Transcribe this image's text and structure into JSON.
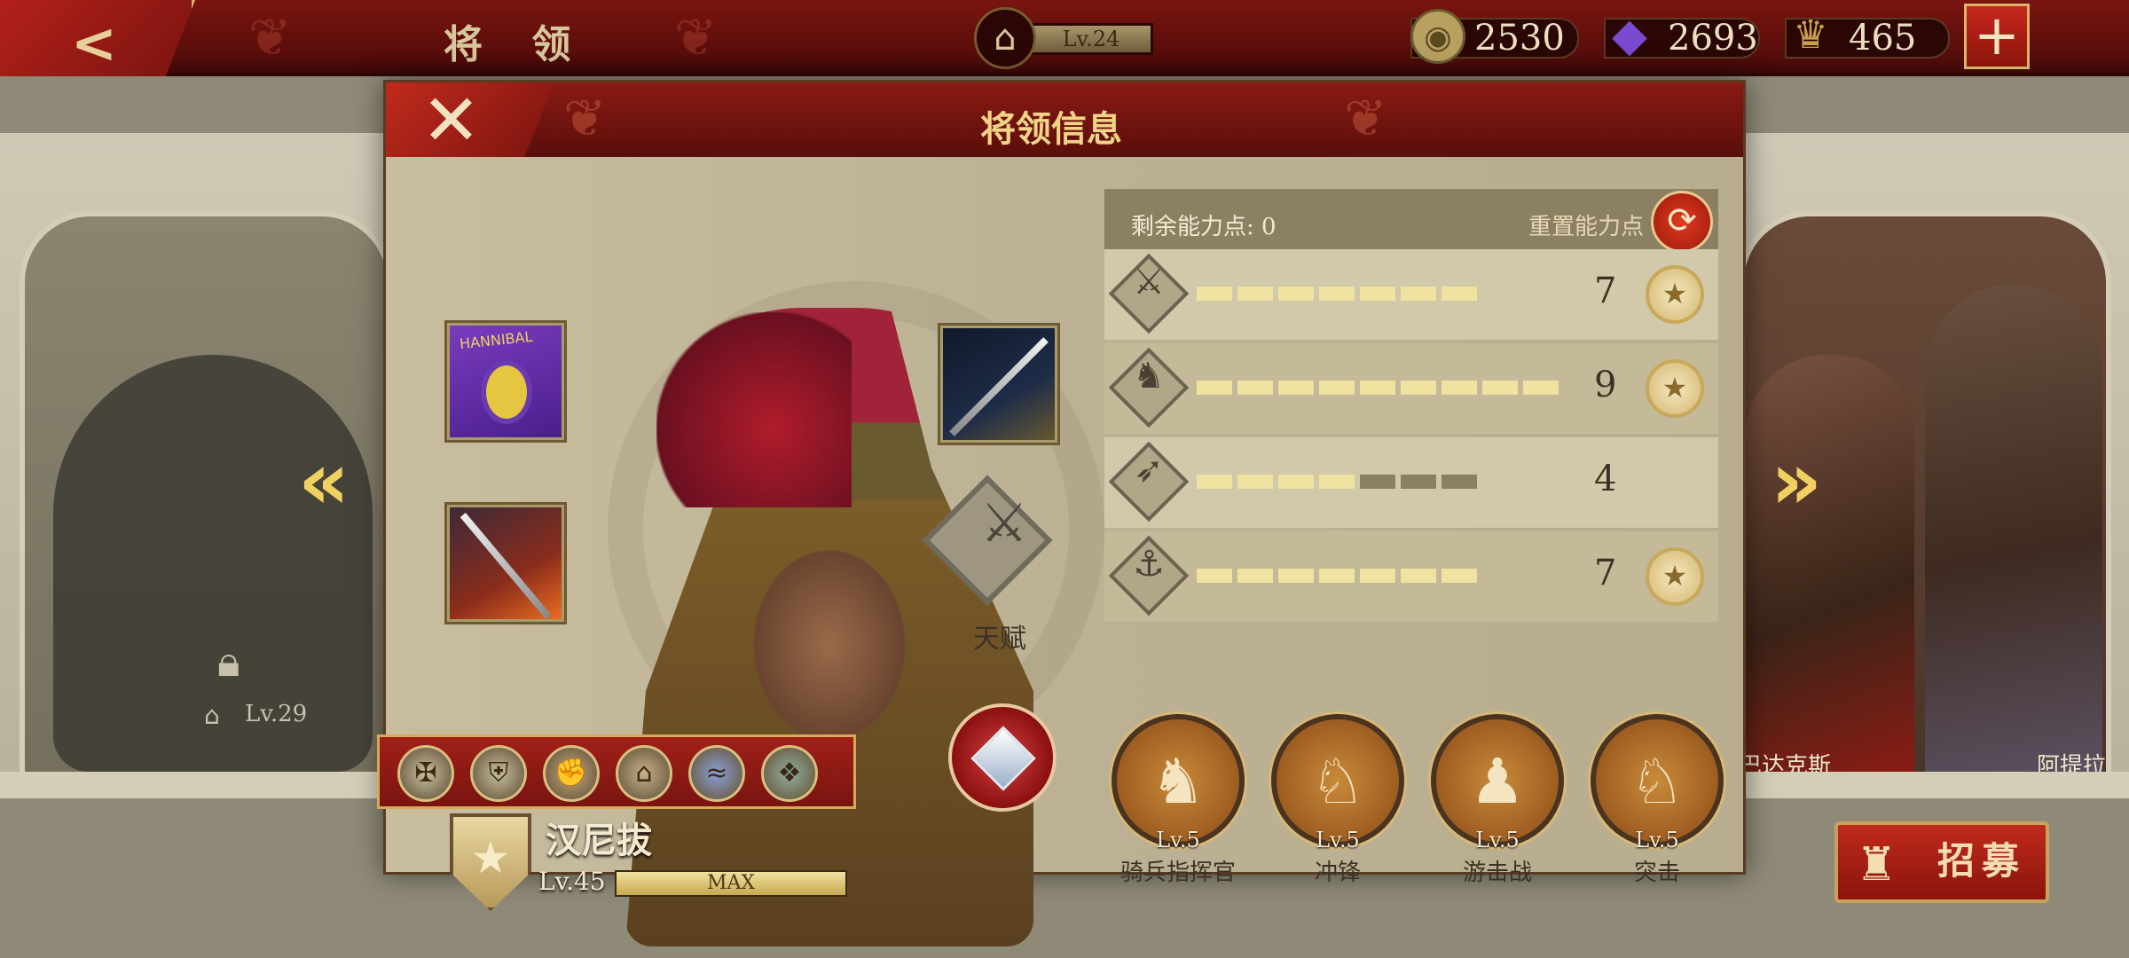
{
  "topbar": {
    "title": "将 领",
    "city_level": "Lv.24",
    "resources": [
      {
        "name": "coin",
        "icon": "coin-icon",
        "value": "2530",
        "color": "#b8a060"
      },
      {
        "name": "gem",
        "icon": "purple-gem-icon",
        "value": "2693",
        "color": "#6a3ab0"
      },
      {
        "name": "spqr",
        "icon": "spqr-eagle-icon",
        "value": "465",
        "color": "#c8a050"
      }
    ],
    "add_label": "+"
  },
  "background": {
    "locked_level": "Lv.29",
    "right_names": [
      "巴达克斯",
      "阿提拉"
    ],
    "recruit_label": "招募"
  },
  "modal": {
    "title": "将领信息",
    "close_label": "✕",
    "general": {
      "name": "汉尼拔",
      "level": "Lv.45",
      "level_bar_label": "MAX",
      "banner_text": "HANNIBAL"
    },
    "talent_label": "天赋",
    "points_label": "剩余能力点: 0",
    "reset_label": "重置能力点",
    "stats": [
      {
        "icon": "sword-icon",
        "glyph": "⚔",
        "value": "7",
        "filled": 7,
        "total": 7,
        "starred": true
      },
      {
        "icon": "horse-icon",
        "glyph": "♞",
        "value": "9",
        "filled": 9,
        "total": 9,
        "starred": true
      },
      {
        "icon": "bow-icon",
        "glyph": "➶",
        "value": "4",
        "filled": 4,
        "total": 7,
        "starred": false
      },
      {
        "icon": "anchor-icon",
        "glyph": "⚓",
        "value": "7",
        "filled": 7,
        "total": 7,
        "starred": true
      }
    ],
    "skills": [
      {
        "level": "Lv.5",
        "name": "骑兵指挥官",
        "glyph": "♞"
      },
      {
        "level": "Lv.5",
        "name": "冲锋",
        "glyph": "♘"
      },
      {
        "level": "Lv.5",
        "name": "游击战",
        "glyph": "♟"
      },
      {
        "level": "Lv.5",
        "name": "突击",
        "glyph": "♘"
      }
    ],
    "badges": [
      {
        "icon": "eagle-badge-icon",
        "glyph": "✠",
        "color": "#c8c0a0"
      },
      {
        "icon": "shield-badge-icon",
        "glyph": "⛨",
        "color": "#c8c0a0"
      },
      {
        "icon": "fist-badge-icon",
        "glyph": "✊",
        "color": "#c8a878"
      },
      {
        "icon": "temple-badge-icon",
        "glyph": "⌂",
        "color": "#c8b088"
      },
      {
        "icon": "wave-badge-icon",
        "glyph": "≈",
        "color": "#8aa0d8"
      },
      {
        "icon": "scarab-badge-icon",
        "glyph": "❖",
        "color": "#90b0a0"
      }
    ]
  }
}
